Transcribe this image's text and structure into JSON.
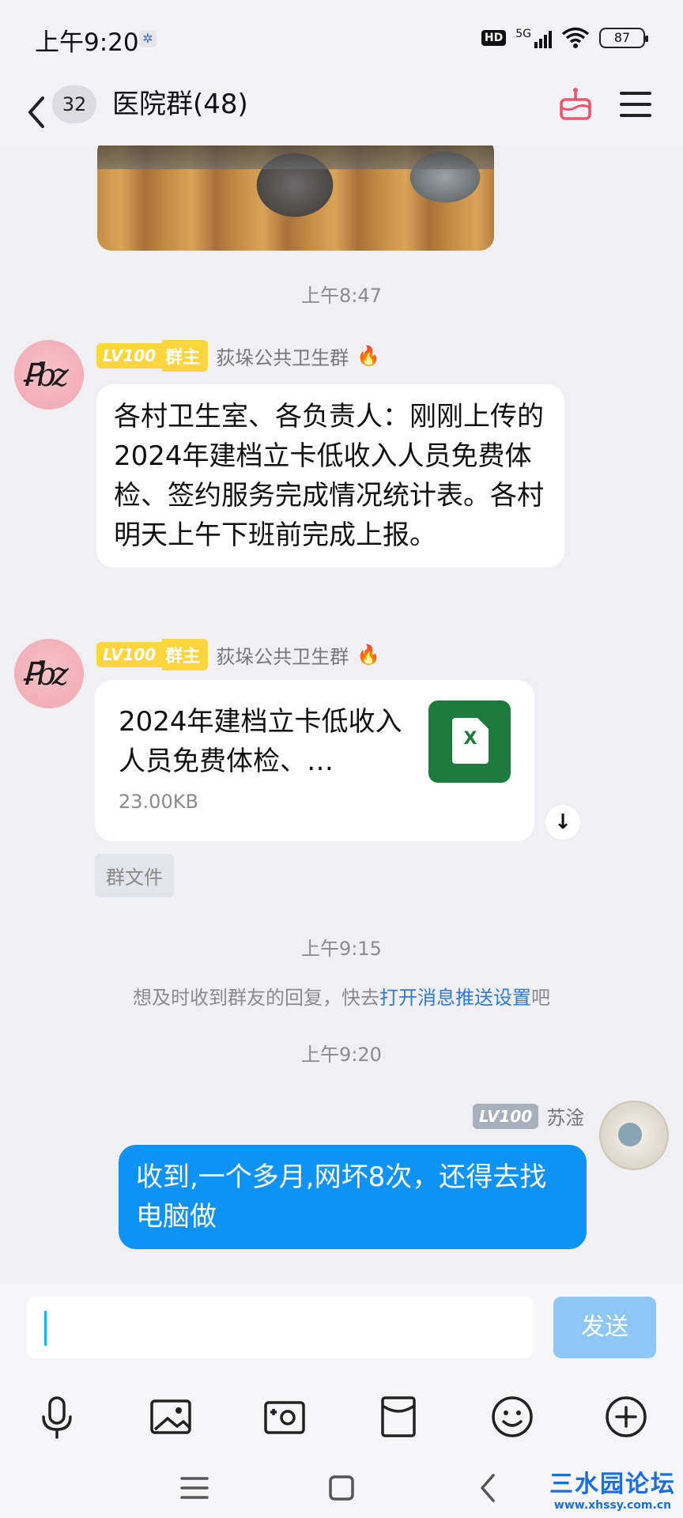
{
  "status_bar": {
    "time": "上午9:20",
    "network": "5G",
    "battery": "87"
  },
  "header": {
    "unread_count": "32",
    "title": "医院群(48)"
  },
  "messages": {
    "ts1": "上午8:47",
    "msg1": {
      "level": "LV100",
      "role": "群主",
      "sender": "荻垛公共卫生群",
      "text": "各村卫生室、各负责人：刚刚上传的2024年建档立卡低收入人员免费体检、签约服务完成情况统计表。各村明天上午下班前完成上报。"
    },
    "msg2": {
      "level": "LV100",
      "role": "群主",
      "sender": "荻垛公共卫生群",
      "file_name": "2024年建档立卡低收入人员免费体检、…",
      "file_size": "23.00KB",
      "file_icon_text": "X",
      "tag": "群文件"
    },
    "ts2": "上午9:15",
    "tip_prefix": "想及时收到群友的回复，快去",
    "tip_link": "打开消息推送设置",
    "tip_suffix": "吧",
    "ts3": "上午9:20",
    "msg3": {
      "level": "LV100",
      "sender": "苏淦",
      "text": "收到,一个多月,网坏8次，还得去找电脑做"
    }
  },
  "input": {
    "send_label": "发送"
  },
  "watermark": {
    "title": "三水园论坛",
    "url": "www.xhssy.com.cn"
  },
  "colors": {
    "accent_blue": "#0f92f5",
    "owner_tag": "#ffd53d",
    "excel_green": "#1e7b3e",
    "gift_icon": "#f0536b"
  }
}
